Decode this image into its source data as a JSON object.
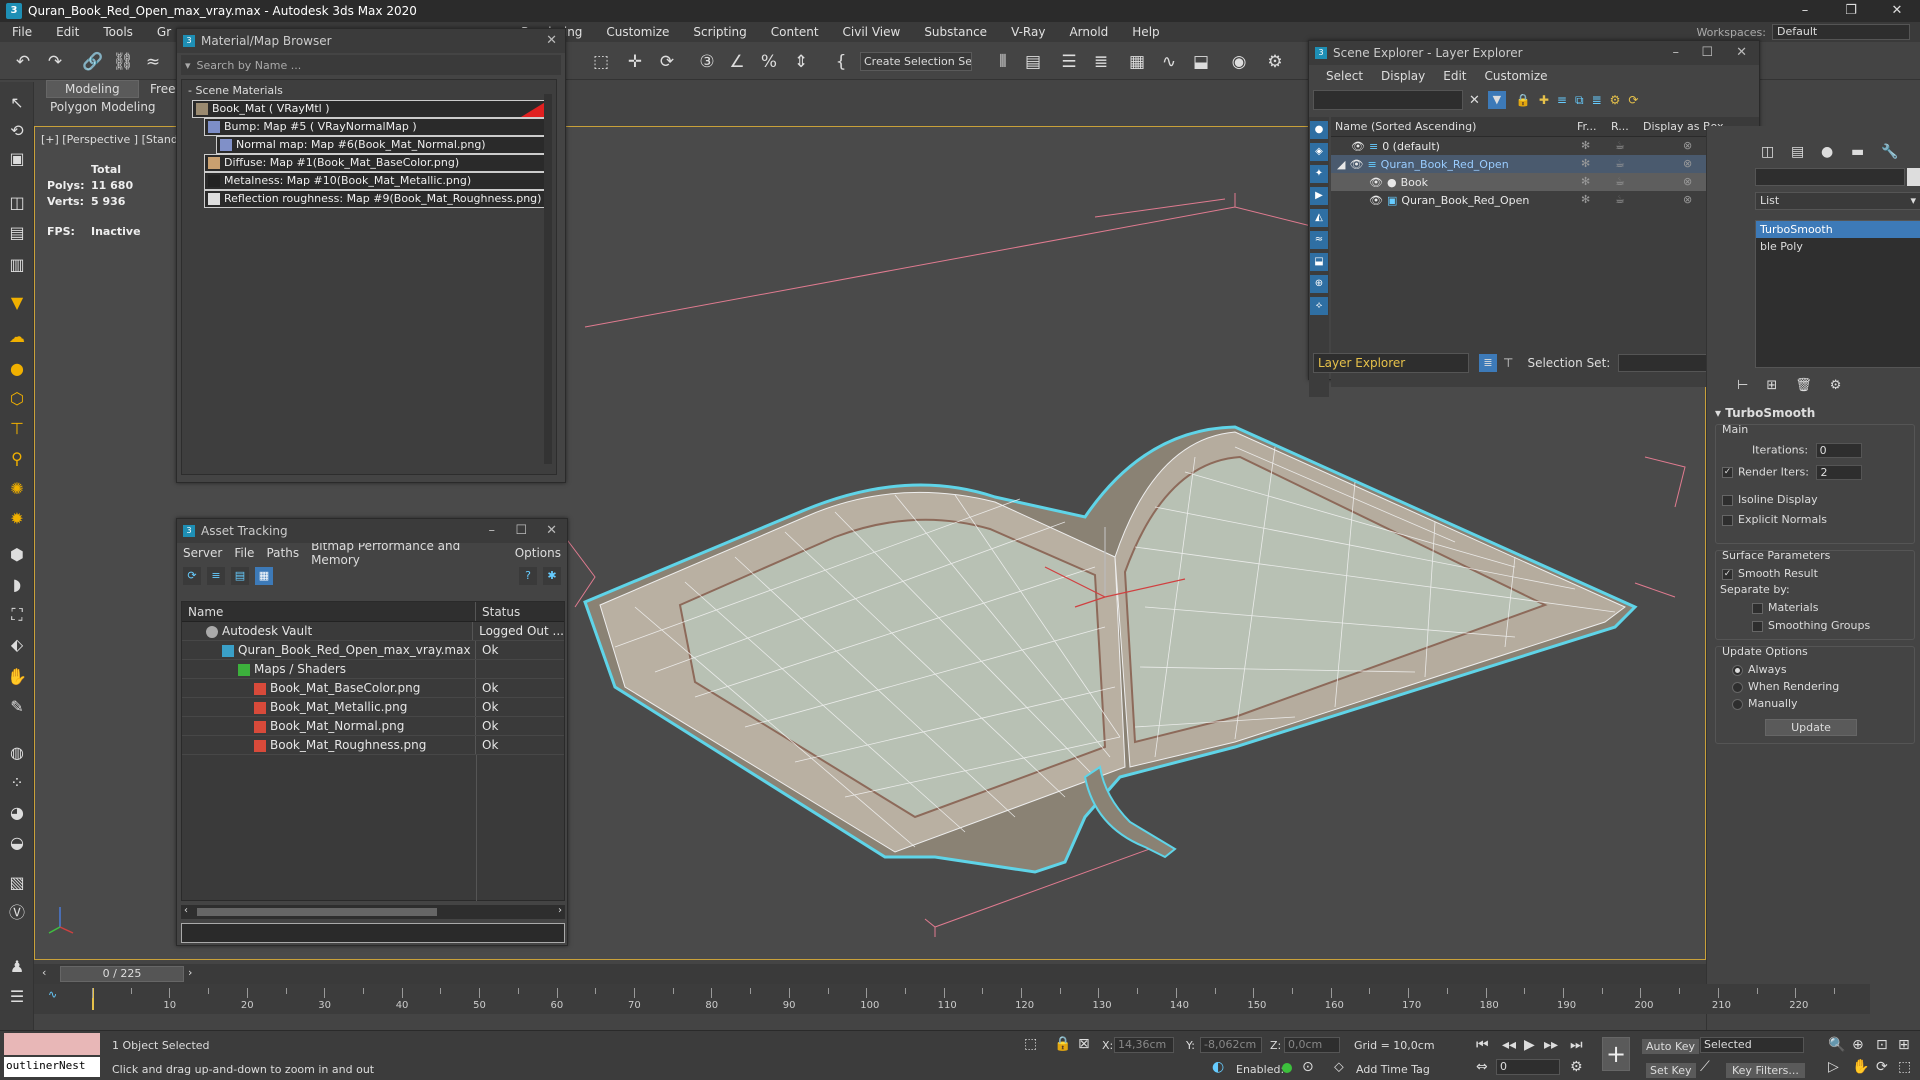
{
  "window": {
    "title": "Quran_Book_Red_Open_max_vray.max - Autodesk 3ds Max 2020"
  },
  "menu": [
    "File",
    "Edit",
    "Tools",
    "Gr",
    "Rendering",
    "Customize",
    "Scripting",
    "Content",
    "Civil View",
    "Substance",
    "V-Ray",
    "Arnold",
    "Help"
  ],
  "workspaces": {
    "label": "Workspaces:",
    "value": "Default"
  },
  "toolbar": {
    "selection_set": "Create Selection Se"
  },
  "ribbon": {
    "tab_modeling": "Modeling",
    "tab_free": "Free",
    "sub": "Polygon Modeling"
  },
  "viewport": {
    "label": "[+] [Perspective ] [Standa",
    "stats": {
      "total": "Total",
      "polys_label": "Polys:",
      "polys": "11 680",
      "verts_label": "Verts:",
      "verts": "5 936",
      "fps_label": "FPS:",
      "fps": "Inactive"
    }
  },
  "material_browser": {
    "title": "Material/Map Browser",
    "search_placeholder": "Search by Name ...",
    "group": "- Scene Materials",
    "items": [
      "Book_Mat  ( VRayMtl )",
      "Bump: Map #5  ( VRayNormalMap )",
      "Normal map: Map #6(Book_Mat_Normal.png)",
      "Diffuse: Map #1(Book_Mat_BaseColor.png)",
      "Metalness: Map #10(Book_Mat_Metallic.png)",
      "Reflection roughness: Map #9(Book_Mat_Roughness.png)"
    ]
  },
  "asset_tracking": {
    "title": "Asset Tracking",
    "menu": [
      "Server",
      "File",
      "Paths",
      "Bitmap Performance and Memory",
      "Options"
    ],
    "columns": {
      "name": "Name",
      "status": "Status"
    },
    "rows": [
      {
        "name": "Autodesk Vault",
        "status": "Logged Out ..."
      },
      {
        "name": "Quran_Book_Red_Open_max_vray.max",
        "status": "Ok"
      },
      {
        "name": "Maps / Shaders",
        "status": ""
      },
      {
        "name": "Book_Mat_BaseColor.png",
        "status": "Ok"
      },
      {
        "name": "Book_Mat_Metallic.png",
        "status": "Ok"
      },
      {
        "name": "Book_Mat_Normal.png",
        "status": "Ok"
      },
      {
        "name": "Book_Mat_Roughness.png",
        "status": "Ok"
      }
    ]
  },
  "scene_explorer": {
    "title": "Scene Explorer - Layer Explorer",
    "menu": [
      "Select",
      "Display",
      "Edit",
      "Customize"
    ],
    "columns": {
      "name": "Name (Sorted Ascending)",
      "fr": "Fr...",
      "r": "R...",
      "box": "Display as Box"
    },
    "rows": [
      "0 (default)",
      "Quran_Book_Red_Open",
      "Book",
      "Quran_Book_Red_Open"
    ],
    "footer": {
      "explorer": "Layer Explorer",
      "selection_set": "Selection Set:"
    }
  },
  "command_panel": {
    "modifier_list": "List",
    "stack": [
      "TurboSmooth",
      "ble Poly"
    ],
    "turbosmooth": {
      "title": "TurboSmooth",
      "main": "Main",
      "iterations_label": "Iterations:",
      "iterations": "0",
      "render_iters_label": "Render Iters:",
      "render_iters": "2",
      "isoline": "Isoline Display",
      "explicit": "Explicit Normals",
      "surface_params": "Surface Parameters",
      "smooth_result": "Smooth Result",
      "separate_by": "Separate by:",
      "materials": "Materials",
      "smoothing_groups": "Smoothing Groups",
      "update_options": "Update Options",
      "always": "Always",
      "when_rendering": "When Rendering",
      "manually": "Manually",
      "update_btn": "Update"
    }
  },
  "timeline": {
    "slider": "0 / 225",
    "ticks": [
      10,
      20,
      30,
      40,
      50,
      60,
      70,
      80,
      90,
      100,
      110,
      120,
      130,
      140,
      150,
      160,
      170,
      180,
      190,
      200,
      210,
      220
    ]
  },
  "status": {
    "maxscript": "outlinerNest",
    "selected": "1 Object Selected",
    "hint": "Click and drag up-and-down to zoom in and out",
    "x_label": "X:",
    "x": "14,36cm",
    "y_label": "Y:",
    "y": "-8,062cm",
    "z_label": "Z:",
    "z": "0,0cm",
    "grid": "Grid = 10,0cm",
    "enabled": "Enabled:",
    "add_time_tag": "Add Time Tag",
    "auto_key": "Auto Key",
    "set_key": "Set Key",
    "selected_dd": "Selected",
    "key_filters": "Key Filters...",
    "frame": "0"
  }
}
